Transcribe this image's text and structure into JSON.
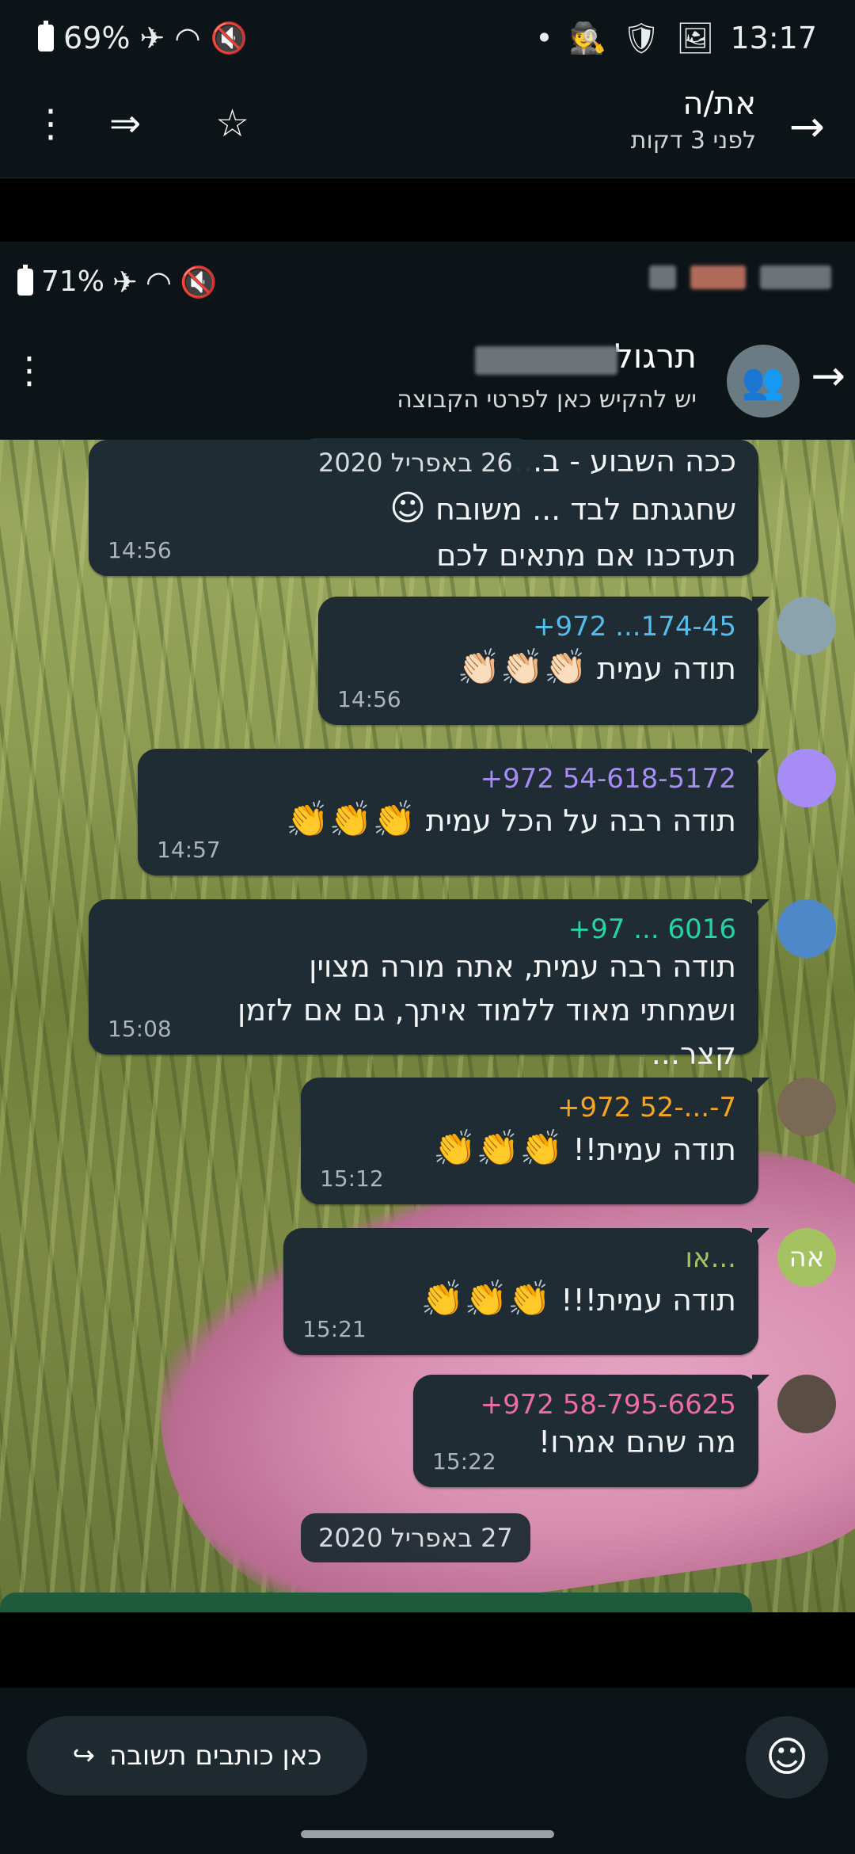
{
  "status_bar": {
    "battery": "69%",
    "time": "13:17"
  },
  "viewer_header": {
    "title": "את/ה",
    "subtitle": "לפני 3 דקות"
  },
  "inner": {
    "status_battery": "71%",
    "group_name": "תרגול",
    "group_subtitle": "יש להקיש כאן לפרטי הקבוצה",
    "first_message": {
      "lines": [
        "ככה השבוע - ב...",
        "שחגגתם לבד ... משובח",
        "תעדכנו אם מתאים לכם"
      ],
      "wink": "☺",
      "time": "14:56"
    },
    "date_chip_1": "26 באפריל 2020",
    "messages": [
      {
        "sender": "+972  ...174-45",
        "sender_color": "#53bdeb",
        "text": "תודה עמית",
        "emoji": "👏🏻👏🏻👏🏻",
        "time": "14:56"
      },
      {
        "sender": "+972 54-618-5172",
        "sender_color": "#a88cf6",
        "text": "תודה רבה על הכל עמית",
        "emoji": "👏👏👏",
        "time": "14:57"
      },
      {
        "sender": "+97 ... 6016",
        "sender_color": "#25d3a4",
        "text": "תודה רבה עמית, אתה מורה מצוין ושמחתי מאוד ללמוד איתך, גם אם לזמן קצר...",
        "emoji": "",
        "time": "15:08"
      },
      {
        "sender": "+972 52-...-7",
        "sender_color": "#f5a524",
        "text": "תודה עמית!!",
        "emoji": "👏👏👏",
        "time": "15:12"
      },
      {
        "sender": "או...",
        "sender_color": "#a5c261",
        "text": "תודה עמית!!!",
        "emoji": "👏👏👏",
        "time": "15:21"
      },
      {
        "sender": "+972 58-795-6625",
        "sender_color": "#ee6ba3",
        "text": "מה שהם אמרו!",
        "emoji": "",
        "time": "15:22"
      }
    ],
    "avatar_initials": "אה",
    "date_chip_2": "27 באפריל 2020"
  },
  "bottom": {
    "reply_label": "כאן כותבים תשובה"
  }
}
